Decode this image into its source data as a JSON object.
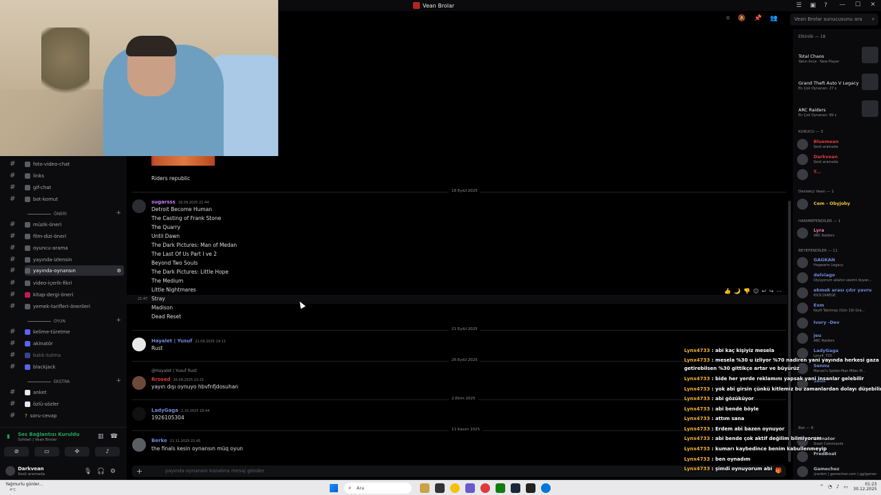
{
  "window": {
    "title": "Vean Brolar",
    "controls": [
      "—",
      "☐",
      "✕"
    ]
  },
  "header": {
    "search_placeholder": "Vean Brolar sunucusunu ara"
  },
  "sidebar": {
    "channels_top": [
      {
        "label": "foto-video-chat"
      },
      {
        "label": "links"
      },
      {
        "label": "gif-chat"
      },
      {
        "label": "bot-komut"
      }
    ],
    "cat_oneri": "ÖNERİ",
    "channels_oneri": [
      {
        "label": "müzik-öneri"
      },
      {
        "label": "film-dizi-öneri"
      },
      {
        "label": "oyuncu-arama"
      },
      {
        "label": "yayında-izlensin"
      },
      {
        "label": "yayında-oynansın"
      },
      {
        "label": "video-içerik-fikri"
      },
      {
        "label": "kitap-dergi-öneri"
      },
      {
        "label": "yemek-tarifleri-önerileri"
      }
    ],
    "cat_oyun": "OYUN",
    "channels_oyun": [
      {
        "label": "kelime-türetme"
      },
      {
        "label": "akinatör"
      },
      {
        "label": "balık-tutma"
      },
      {
        "label": "blackjack"
      }
    ],
    "cat_ekstra": "EKSTRA",
    "channels_ekstra": [
      {
        "label": "anket"
      },
      {
        "label": "özlü-sözler"
      },
      {
        "label": "soru-cevap"
      }
    ]
  },
  "voice": {
    "status": "Ses Bağlantısı Kuruldu",
    "sub": "Sohbet | Vean Brolar"
  },
  "user": {
    "name": "Darkvean",
    "status": "Sesli aramada"
  },
  "chat": {
    "prev_message": "Riders republic",
    "dividers": [
      "18 Eylül 2025",
      "21 Eylül 2025",
      "26 Eylül 2025",
      "2 Ekim 2025",
      "11 Kasım 2025"
    ],
    "messages": [
      {
        "author": "sugarsss",
        "timestamp": "18.09.2025 21:44",
        "lines": [
          "Detroit Become Human",
          "The Casting of Frank Stone",
          "The Quarry",
          "Until Dawn",
          "The Dark Pictures: Man of Medan",
          "The Last Of Us Part I ve 2",
          "Beyond Two Souls",
          "The Dark Pictures: Little Hope",
          "The Medium",
          "Little Nightmares",
          "Stray",
          "Madison",
          "Dead Reset"
        ],
        "hover_time": "21:47",
        "edited": "(düzenlendi)"
      },
      {
        "author": "Hayalet | Yusuf",
        "timestamp": "21.09.2025 14:11",
        "lines": [
          "Rust"
        ]
      },
      {
        "reply_to": "@Hayalet | Yusuf Rust",
        "author": "Rrosed",
        "timestamp": "26.09.2025 22:21",
        "lines": [
          "yayın dışı oynuyo hbvfnfjdosuhan"
        ]
      },
      {
        "author": "LadyGaga",
        "timestamp": "2.10.2025 18:44",
        "lines": [
          "1926105304"
        ]
      },
      {
        "author": "Berke",
        "timestamp": "11.11.2025 22:45",
        "lines": [
          "the finals kesin oynansın müq oyun"
        ]
      }
    ],
    "composer_placeholder": "yayında-oynansın kanalına mesaj gönder"
  },
  "members": {
    "activity_header": "Etkinlik — 18",
    "activities": [
      {
        "title": "Total Chaos",
        "sub": "Yakın önce · New Player"
      },
      {
        "title": "Grand Theft Auto V Legacy",
        "sub": "En Çok Oynanan: 27 s"
      },
      {
        "title": "ARC Raiders",
        "sub": "En Çok Oynanan: 89 s"
      }
    ],
    "group_kurucu": "KURUCU — 3",
    "kurucu": [
      {
        "name": "Bluemean",
        "sub": "Sesli aramada",
        "color": "#e03b3b"
      },
      {
        "name": "Darkvean",
        "sub": "Sesli aramada",
        "color": "#e03b3b"
      },
      {
        "name": "T...",
        "sub": "",
        "color": "#e03b3b"
      }
    ],
    "group_destekci": "Destekçi Vean — 1",
    "destekci": [
      {
        "name": "Cem - Obyjoby",
        "sub": "",
        "color": "#f0c43a"
      }
    ],
    "group_hanimefendiler": "HANIMEFENDİLER — 1",
    "hanim": [
      {
        "name": "Lyra",
        "sub": "ARC Raiders",
        "color": "#e87ab5"
      }
    ],
    "group_beyefendiler": "BEYEFENDİLER — 11",
    "beyler": [
      {
        "name": "GAGKAN",
        "sub": "Hogwarts Legacy",
        "color": "#7289da"
      },
      {
        "name": "delviago",
        "sub": "Ölçüyorum allahın sesimi duyan...",
        "color": "#7289da"
      },
      {
        "name": "ekmek arası çıtır yavru",
        "sub": "KICK.DIAEGE",
        "color": "#7289da"
      },
      {
        "name": "Exm",
        "sub": "Keyfi Takılmaç (Gün 19) Gra...",
        "color": "#7289da"
      },
      {
        "name": "Ivory -Dev",
        "sub": "",
        "color": "#7289da"
      },
      {
        "name": "jeu",
        "sub": "ARC Raiders",
        "color": "#7289da"
      },
      {
        "name": "LadyGaga",
        "sub": "Lynx4_733",
        "color": "#7289da"
      },
      {
        "name": "Sennu",
        "sub": "Marvel's Spider-Man Miles M...",
        "color": "#7289da"
      },
      {
        "name": "Seox",
        "sub": "",
        "color": "#7289da"
      }
    ],
    "group_bot": "Bot — 8",
    "bots": [
      {
        "name": "Akinator",
        "sub": "Slash Commands",
        "color": "#b5bac1"
      },
      {
        "name": "FredBoat",
        "sub": "",
        "color": "#b5bac1"
      },
      {
        "name": "Gamechez",
        "sub": "/yardım | gamechez.com | gg/gamec",
        "color": "#b5bac1"
      }
    ]
  },
  "overlay_chat": [
    {
      "nick": "Lynx4733",
      "text": "abi kaç kişiyiz mesela"
    },
    {
      "nick": "Lynx4733",
      "text": "mesela %30 u izliyor %70 nadiren yani yayında herkesi gaza"
    },
    {
      "nick": "",
      "text": "getirebilsen %30 gittikçe artar ve büyürüz"
    },
    {
      "nick": "Lynx4733",
      "text": "bide her yerde reklamını yapsak yani insanlar gelebilir"
    },
    {
      "nick": "Lynx4733",
      "text": "yok abi girsin çünkü kitlemiz bu zamanlardan dolayı düşebilir"
    },
    {
      "nick": "Lynx4733",
      "text": "abi gözüküyor"
    },
    {
      "nick": "Lynx4733",
      "text": "abi bende böyle"
    },
    {
      "nick": "Lynx4733",
      "text": "attım sana"
    },
    {
      "nick": "Lynx4733",
      "text": "Erdem abi bazen oynuyor"
    },
    {
      "nick": "Lynx4733",
      "text": "abi bende çok aktif değilim bilmiyorum"
    },
    {
      "nick": "Lynx4733",
      "text": "kumarı kaybedince benim kabullenmeyip"
    },
    {
      "nick": "Lynx4733",
      "text": "ben oynadım"
    },
    {
      "nick": "Lynx4733",
      "text": "şimdi oynuyorum abi"
    }
  ],
  "taskbar": {
    "weather": "Yağmurlu günler...",
    "weather_sub": "4°C",
    "search": "Ara",
    "time": "01:23",
    "date": "30.12.2025"
  }
}
